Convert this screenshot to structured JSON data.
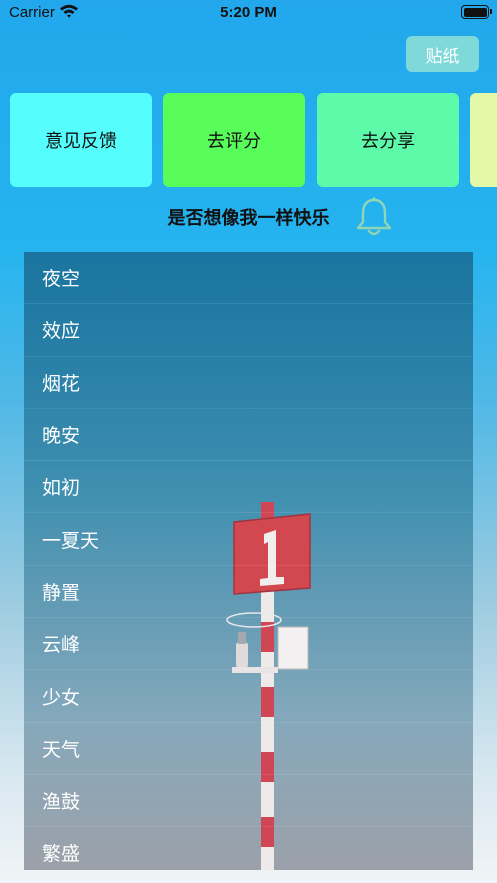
{
  "status_bar": {
    "carrier": "Carrier",
    "time": "5:20 PM",
    "icons": [
      "wifi-icon",
      "battery-icon"
    ]
  },
  "header": {
    "sticker_button": "贴纸"
  },
  "cards": [
    {
      "label": "意见反馈",
      "color": "#55fdfc"
    },
    {
      "label": "去评分",
      "color": "#58fd5a"
    },
    {
      "label": "去分享",
      "color": "#5dfaa9"
    },
    {
      "label": "",
      "color": "#e4f9a8"
    }
  ],
  "tagline": {
    "text": "是否想像我一样快乐",
    "icon": "bell-icon"
  },
  "list": {
    "items": [
      "夜空",
      "效应",
      "烟花",
      "晚安",
      "如初",
      "一夏天",
      "静置",
      "云峰",
      "少女",
      "天气",
      "渔鼓",
      "繁盛"
    ]
  }
}
